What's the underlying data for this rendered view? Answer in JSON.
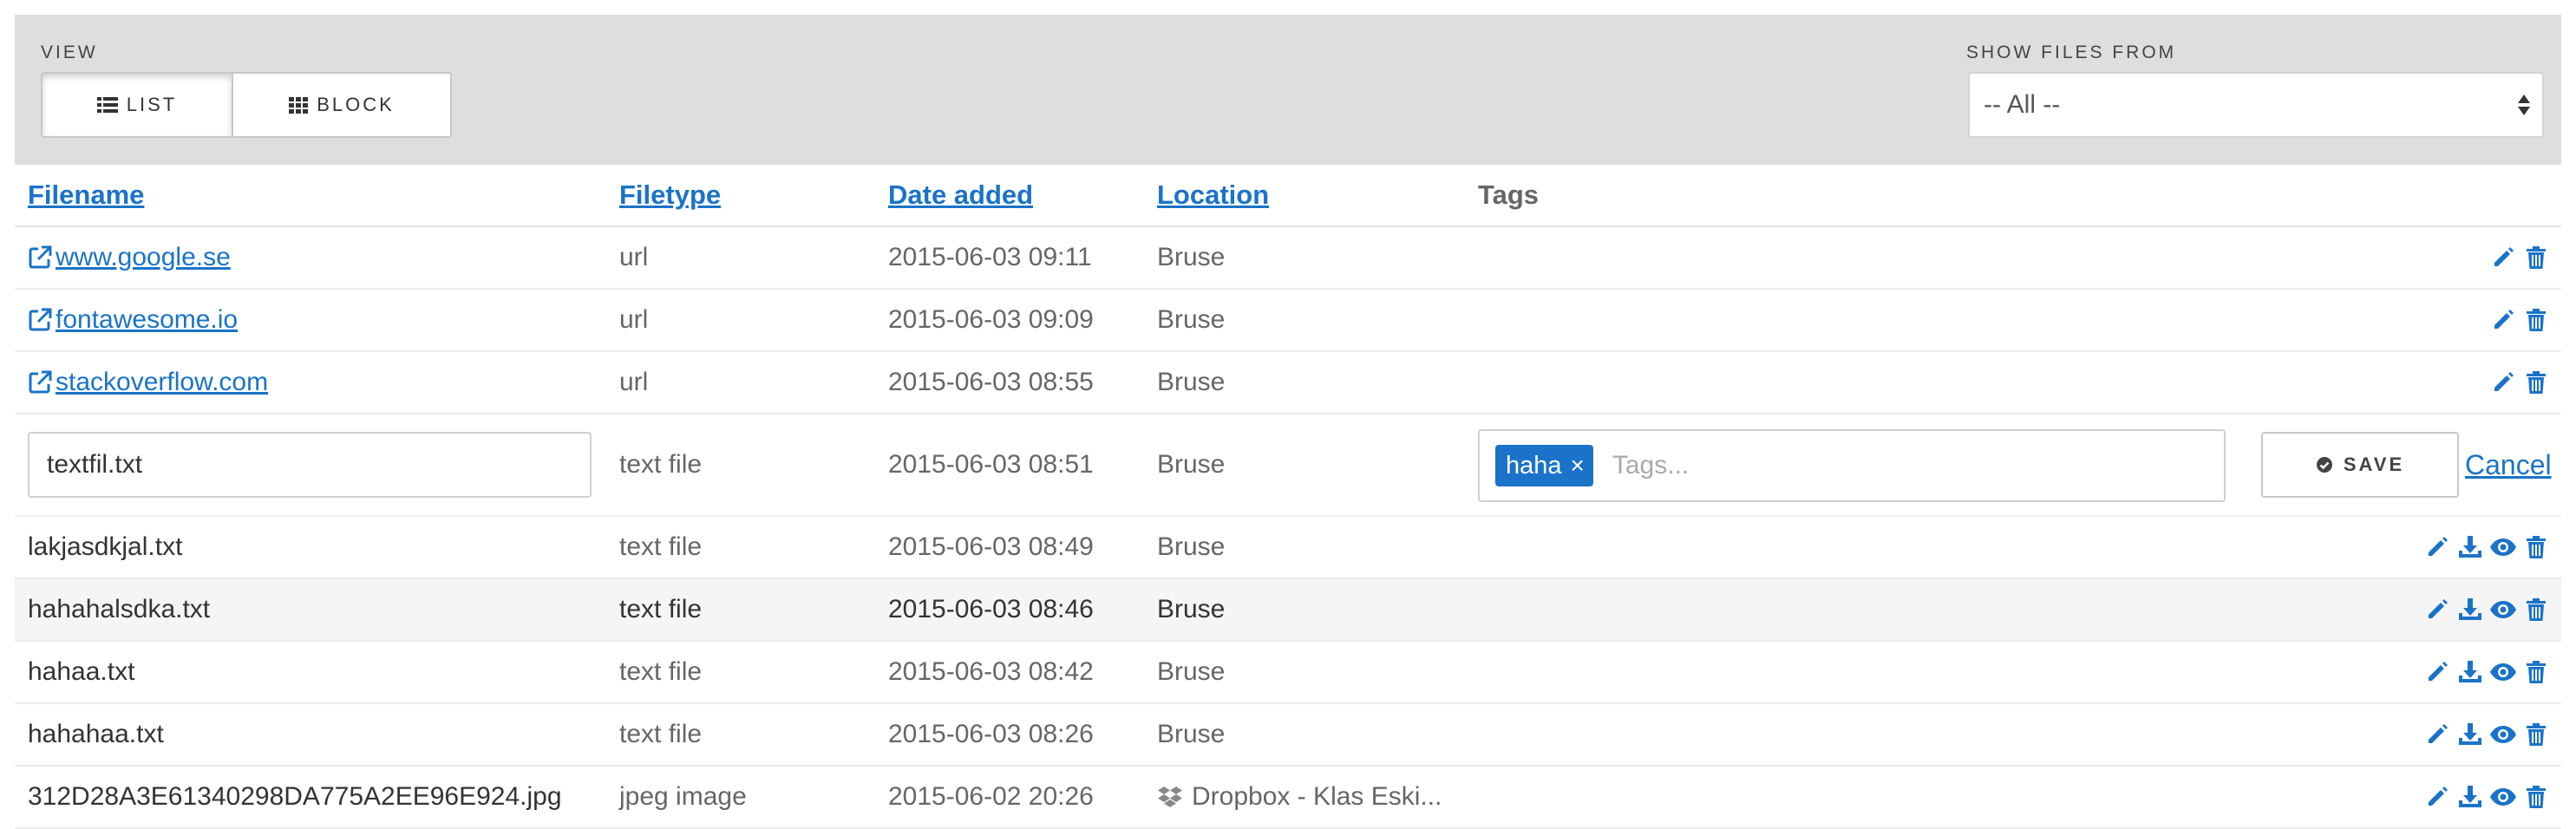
{
  "filter": {
    "view_label": "VIEW",
    "list_label": "LIST",
    "block_label": "BLOCK",
    "show_label": "SHOW FILES FROM",
    "show_value": "-- All --"
  },
  "columns": {
    "filename": "Filename",
    "filetype": "Filetype",
    "date": "Date added",
    "location": "Location",
    "tags": "Tags"
  },
  "url_rows": [
    {
      "name": " www.google.se",
      "type": "url",
      "date": "2015-06-03 09:11",
      "location": "Bruse"
    },
    {
      "name": " fontawesome.io",
      "type": "url",
      "date": "2015-06-03 09:09",
      "location": "Bruse"
    },
    {
      "name": " stackoverflow.com",
      "type": "url",
      "date": "2015-06-03 08:55",
      "location": "Bruse"
    }
  ],
  "edit_row": {
    "name_value": "textfil.txt",
    "type": "text file",
    "date": "2015-06-03 08:51",
    "location": "Bruse",
    "tag": "haha",
    "tag_remove": "×",
    "tags_placeholder": "Tags...",
    "save_label": "SAVE",
    "cancel_label": "Cancel"
  },
  "file_rows": [
    {
      "name": "lakjasdkjal.txt",
      "type": "text file",
      "date": "2015-06-03 08:49",
      "location": "Bruse"
    },
    {
      "name": "hahahalsdka.txt",
      "type": "text file",
      "date": "2015-06-03 08:46",
      "location": "Bruse"
    },
    {
      "name": "hahaa.txt",
      "type": "text file",
      "date": "2015-06-03 08:42",
      "location": "Bruse"
    },
    {
      "name": "hahahaa.txt",
      "type": "text file",
      "date": "2015-06-03 08:26",
      "location": "Bruse"
    },
    {
      "name": "312D28A3E61340298DA775A2EE96E924.jpg",
      "type": "jpeg image",
      "date": "2015-06-02 20:26",
      "location": "Dropbox - Klas Eski..."
    }
  ],
  "colors": {
    "accent": "#1a73c8",
    "bar": "#dedede",
    "row_alt": "#f5f5f5"
  }
}
